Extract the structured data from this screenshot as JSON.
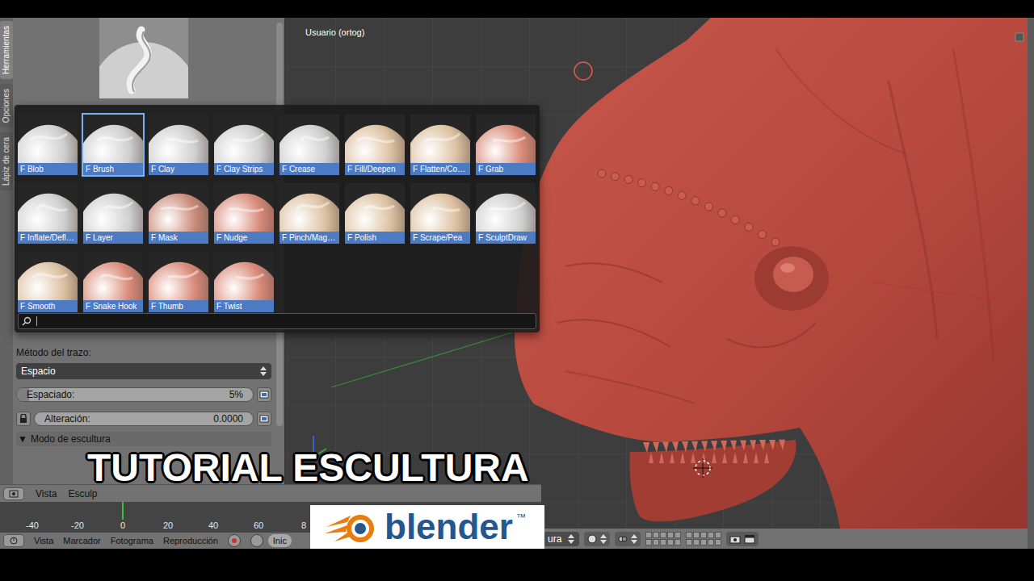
{
  "tool_panel": {
    "tabs": [
      {
        "label": "Herramientas",
        "selected": true
      },
      {
        "label": "Opciones",
        "selected": false
      },
      {
        "label": "Lápiz de cera",
        "selected": false
      }
    ],
    "stroke_method_label": "Método del trazo:",
    "stroke_method": "Espacio",
    "sliders": [
      {
        "label": "Espaciado:",
        "value": "5%",
        "level": 0.05,
        "kind": "slider"
      },
      {
        "label": "Alteración:",
        "value": "0.0000",
        "level": 0,
        "kind": "locked-slider"
      }
    ],
    "section": {
      "arrow": "▼",
      "label": "Modo de escultura",
      "expanded": true
    }
  },
  "brush_popup": {
    "brushes": [
      {
        "label": "F Blob",
        "selected": false,
        "color": "#cfcfcf"
      },
      {
        "label": "F Brush",
        "selected": true,
        "color": "#cfcfcf"
      },
      {
        "label": "F Clay",
        "selected": false,
        "color": "#cfcfcf"
      },
      {
        "label": "F Clay Strips",
        "selected": false,
        "color": "#cfcfcf"
      },
      {
        "label": "F Crease",
        "selected": false,
        "color": "#cfcfcf"
      },
      {
        "label": "F Fill/Deepen",
        "selected": false,
        "color": "#dcc0a0"
      },
      {
        "label": "F Flatten/Co…",
        "selected": false,
        "color": "#dcc0a0"
      },
      {
        "label": "F Grab",
        "selected": false,
        "color": "#d98a78"
      },
      {
        "label": "F Inflate/Defl…",
        "selected": false,
        "color": "#cfcfcf"
      },
      {
        "label": "F Layer",
        "selected": false,
        "color": "#cfcfcf"
      },
      {
        "label": "F Mask",
        "selected": false,
        "color": "#c98b7a"
      },
      {
        "label": "F Nudge",
        "selected": false,
        "color": "#d98a78"
      },
      {
        "label": "F Pinch/Mag…",
        "selected": false,
        "color": "#dcc0a0"
      },
      {
        "label": "F Polish",
        "selected": false,
        "color": "#dcc0a0"
      },
      {
        "label": "F Scrape/Pea",
        "selected": false,
        "color": "#dcc0a0"
      },
      {
        "label": "F SculptDraw",
        "selected": false,
        "color": "#cfcfcf"
      },
      {
        "label": "F Smooth",
        "selected": false,
        "color": "#dcc0a0"
      },
      {
        "label": "F Snake Hook",
        "selected": false,
        "color": "#d98a78"
      },
      {
        "label": "F Thumb",
        "selected": false,
        "color": "#d98a78"
      },
      {
        "label": "F Twist",
        "selected": false,
        "color": "#d98a78"
      }
    ]
  },
  "viewport": {
    "label": "Usuario (ortog)",
    "mode": "ura"
  },
  "editor_header": {
    "menus": [
      "Vista",
      "Esculp"
    ]
  },
  "timeline": {
    "ticks": [
      {
        "label": "-40",
        "current": false
      },
      {
        "label": "-20",
        "current": false
      },
      {
        "label": "0",
        "current": true
      },
      {
        "label": "20",
        "current": false
      },
      {
        "label": "40",
        "current": false
      },
      {
        "label": "60",
        "current": false
      },
      {
        "label": "8",
        "current": false
      }
    ]
  },
  "timeline_header": {
    "menus": [
      "Vista",
      "Marcador",
      "Fotograma",
      "Reproducción"
    ],
    "start_field": "Inic"
  },
  "overlay": {
    "title": "TUTORIAL ESCULTURA",
    "logo": {
      "text": "blender",
      "mark": "™"
    }
  }
}
